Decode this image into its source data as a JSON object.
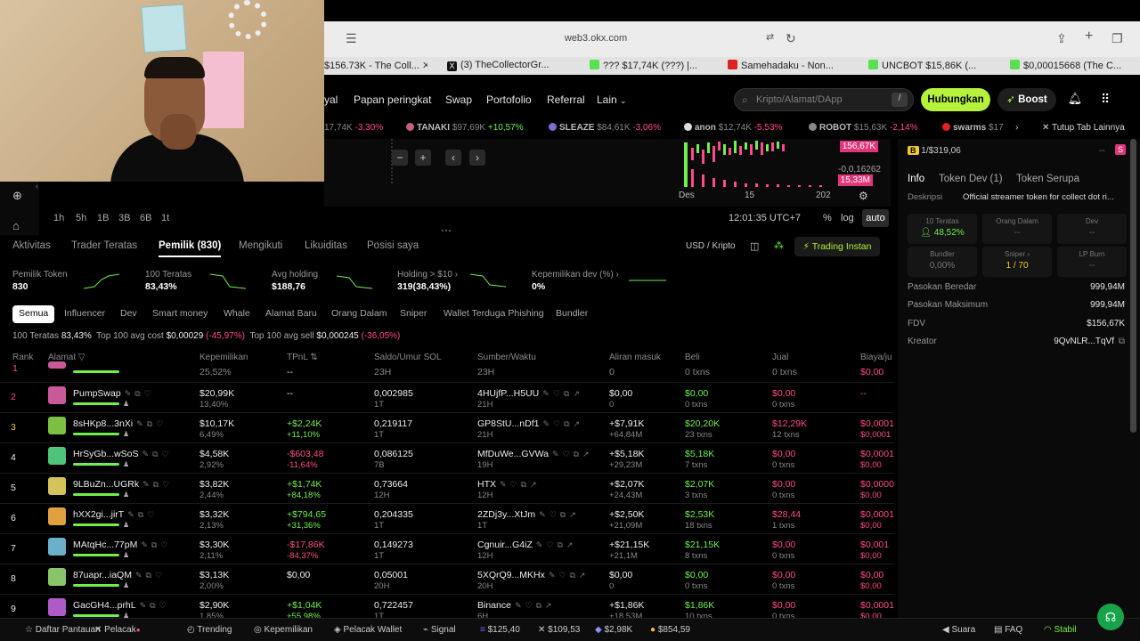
{
  "browser": {
    "url": "web3.okx.com",
    "tabs": [
      {
        "label": "$156.73K - The Coll...",
        "color": "#e2e2e2"
      },
      {
        "label": "(3) TheCollectorGr...",
        "color": "#111111"
      },
      {
        "label": "??? $17,74K (???) |...",
        "color": "#58e04f"
      },
      {
        "label": "Samehadaku - Non...",
        "color": "#d22"
      },
      {
        "label": "UNCBOT $15,86K (...",
        "color": "#58e04f"
      },
      {
        "label": "$0,00015668 (The C...",
        "color": "#58e04f"
      }
    ]
  },
  "nav": {
    "items": [
      "yal",
      "Papan peringkat",
      "Swap",
      "Portofolio",
      "Referral",
      "Lain"
    ],
    "search_placeholder": "Kripto/Alamat/DApp",
    "search_kbd": "/",
    "connect_label": "Hubungkan",
    "boost_label": "Boost"
  },
  "ticker": [
    {
      "name": "",
      "mc": "17,74K",
      "chg": "-3,30%",
      "dir": "neg",
      "color": ""
    },
    {
      "name": "TANAKI",
      "mc": "$97,69K",
      "chg": "+10,57%",
      "dir": "pos",
      "color": "#c4607a"
    },
    {
      "name": "SLEAZE",
      "mc": "$84,61K",
      "chg": "-3,06%",
      "dir": "neg",
      "color": "#7a6fd0"
    },
    {
      "name": "anon",
      "mc": "$12,74K",
      "chg": "-5,53%",
      "dir": "neg",
      "color": "#ddd"
    },
    {
      "name": "ROBOT",
      "mc": "$15,63K",
      "chg": "-2,14%",
      "dir": "neg",
      "color": "#888"
    },
    {
      "name": "swarms",
      "mc": "$17",
      "chg": "",
      "dir": "neg",
      "color": "#d22"
    }
  ],
  "ticker_close": "Tutup Tab Lainnya",
  "chart": {
    "price_badge_1": "156,67K",
    "price_badge_2": "15,33M",
    "axis_val": "-0,0,16262",
    "x_labels": [
      "Des",
      "15",
      "202"
    ],
    "timeframes": [
      "1h",
      "5h",
      "1B",
      "3B",
      "6B",
      "1t"
    ],
    "clock": "12:01:35 UTC+7",
    "pct": "%",
    "log": "log",
    "auto": "auto"
  },
  "right_panel": {
    "bundle_row": "1/$319,06",
    "tabs": [
      "Info",
      "Token Dev (1)",
      "Token Serupa"
    ],
    "desc_label": "Deskripsi",
    "desc_value": "Official streamer token for collect dot ri...",
    "stats": [
      {
        "label": "10 Teratas",
        "value": "48,52%",
        "tone": "pos"
      },
      {
        "label": "Orang Dalam",
        "value": "--",
        "tone": "dim"
      },
      {
        "label": "Dev",
        "value": "--",
        "tone": "dim"
      },
      {
        "label": "Bundler",
        "value": "0,00%",
        "tone": "dim"
      },
      {
        "label": "Sniper",
        "value": "1 / 70",
        "tone": "warn"
      },
      {
        "label": "LP Burn",
        "value": "--",
        "tone": "dim"
      }
    ],
    "rows": [
      {
        "label": "Pasokan Beredar",
        "value": "999,94M"
      },
      {
        "label": "Pasokan Maksimum",
        "value": "999,94M"
      },
      {
        "label": "FDV",
        "value": "$156,67K"
      },
      {
        "label": "Kreator",
        "value": "9QvNLR...TqVf"
      }
    ]
  },
  "main_tabs": [
    "Aktivitas",
    "Trader Teratas",
    "Pemilik (830)",
    "Mengikuti",
    "Likuiditas",
    "Posisi saya"
  ],
  "currency_toggle": "USD / Kripto",
  "trade_btn": "Trading Instan",
  "summary": [
    {
      "label": "Pemilik Token",
      "value": "830"
    },
    {
      "label": "100 Teratas",
      "value": "83,43%"
    },
    {
      "label": "Avg holding",
      "value": "$188,76"
    },
    {
      "label": "Holding > $10",
      "value": "319(38,43%)"
    },
    {
      "label": "Kepemilikan dev (%)",
      "value": "0%"
    }
  ],
  "chips": [
    "Semua",
    "Influencer",
    "Dev",
    "Smart money",
    "Whale",
    "Alamat Baru",
    "Orang Dalam",
    "Sniper",
    "Wallet Terduga Phishing",
    "Bundler"
  ],
  "aggregate": {
    "top100_label": "100 Teratas",
    "top100_value": "83,43%",
    "avg_cost_label": "Top 100 avg cost",
    "avg_cost_value": "$0,00029",
    "avg_cost_chg": "(-45,97%)",
    "avg_sell_label": "Top 100 avg sell",
    "avg_sell_value": "$0,000245",
    "avg_sell_chg": "(-36,05%)"
  },
  "table": {
    "headers": [
      "Rank",
      "Alamat",
      "Kepemilikan",
      "TPnL",
      "Saldo/Umur SOL",
      "Sumber/Waktu",
      "Aliran masuk",
      "Beli",
      "Jual",
      "Biaya/ju"
    ],
    "partial_row": {
      "rank": "1",
      "hold_pct": "25,52%",
      "pnl": "--",
      "age": "23H",
      "src_age": "23H",
      "flow": "0",
      "buy": "0 txns",
      "sell": "0 txns",
      "fee": "$0,00"
    },
    "rows": [
      {
        "rank": "2",
        "addr": "PumpSwap",
        "hold": "$20,99K",
        "hold_pct": "13,40%",
        "pnl": "--",
        "pnl_pct": "",
        "pnl_dir": "w",
        "sol": "0,002985",
        "age": "1T",
        "src": "4HUjfP...H5UU",
        "src_age": "21H",
        "flow": "$0,00",
        "flow_sub": "0",
        "buy": "$0,00",
        "buy_tx": "0 txns",
        "sell": "$0,00",
        "sell_tx": "0 txns",
        "fee": "--",
        "fee2": "",
        "avatar": "#c85a9a",
        "rank_col": "#ff4a8a"
      },
      {
        "rank": "3",
        "addr": "8sHKp8...3nXi",
        "hold": "$10,17K",
        "hold_pct": "6,49%",
        "pnl": "+$2,24K",
        "pnl_pct": "+11,10%",
        "pnl_dir": "g",
        "sol": "0,219117",
        "age": "1T",
        "src": "GP8StU...nDf1",
        "src_age": "21H",
        "flow": "+$7,91K",
        "flow_sub": "+64,84M",
        "buy": "$20,20K",
        "buy_tx": "23 txns",
        "sell": "$12,29K",
        "sell_tx": "12 txns",
        "fee": "$0,0001",
        "fee2": "$0,0001",
        "avatar": "#7bc043",
        "rank_col": "#f5c542"
      },
      {
        "rank": "4",
        "addr": "HrSyGb...wSoS",
        "hold": "$4,58K",
        "hold_pct": "2,92%",
        "pnl": "-$603,48",
        "pnl_pct": "-11,64%",
        "pnl_dir": "r",
        "sol": "0,086125",
        "age": "7B",
        "src": "MfDuWe...GVWa",
        "src_age": "19H",
        "flow": "+$5,18K",
        "flow_sub": "+29,23M",
        "buy": "$5,18K",
        "buy_tx": "7 txns",
        "sell": "$0,00",
        "sell_tx": "0 txns",
        "fee": "$0,0001",
        "fee2": "$0,00",
        "avatar": "#4fc37a",
        "rank_col": "#eee"
      },
      {
        "rank": "5",
        "addr": "9LBuZn...UGRk",
        "hold": "$3,82K",
        "hold_pct": "2,44%",
        "pnl": "+$1,74K",
        "pnl_pct": "+84,18%",
        "pnl_dir": "g",
        "sol": "0,73664",
        "age": "12H",
        "src": "HTX",
        "src_age": "12H",
        "flow": "+$2,07K",
        "flow_sub": "+24,43M",
        "buy": "$2,07K",
        "buy_tx": "3 txns",
        "sell": "$0,00",
        "sell_tx": "0 txns",
        "fee": "$0,0000",
        "fee2": "$0,00",
        "avatar": "#d4c35a",
        "rank_col": "#eee"
      },
      {
        "rank": "6",
        "addr": "hXX2gi...jirT",
        "hold": "$3,32K",
        "hold_pct": "2,13%",
        "pnl": "+$794,65",
        "pnl_pct": "+31,36%",
        "pnl_dir": "g",
        "sol": "0,204335",
        "age": "1T",
        "src": "2ZDj3y...XtJm",
        "src_age": "1T",
        "flow": "+$2,50K",
        "flow_sub": "+21,09M",
        "buy": "$2,53K",
        "buy_tx": "18 txns",
        "sell": "$28,44",
        "sell_tx": "1 txns",
        "fee": "$0,0001",
        "fee2": "$0,00",
        "avatar": "#e0a040",
        "rank_col": "#eee"
      },
      {
        "rank": "7",
        "addr": "MAtqHc...77pM",
        "hold": "$3,30K",
        "hold_pct": "2,11%",
        "pnl": "-$17,86K",
        "pnl_pct": "-84,37%",
        "pnl_dir": "r",
        "sol": "0,149273",
        "age": "1T",
        "src": "Cgnuir...G4iZ",
        "src_age": "12H",
        "flow": "+$21,15K",
        "flow_sub": "+21,1M",
        "buy": "$21,15K",
        "buy_tx": "8 txns",
        "sell": "$0,00",
        "sell_tx": "0 txns",
        "fee": "$0,001",
        "fee2": "$0,00",
        "avatar": "#6ab0c8",
        "rank_col": "#eee"
      },
      {
        "rank": "8",
        "addr": "87uapr...iaQM",
        "hold": "$3,13K",
        "hold_pct": "2,00%",
        "pnl": "$0,00",
        "pnl_pct": "",
        "pnl_dir": "w",
        "sol": "0,05001",
        "age": "20H",
        "src": "5XQrQ9...MKHx",
        "src_age": "20H",
        "flow": "$0,00",
        "flow_sub": "0",
        "buy": "$0,00",
        "buy_tx": "0 txns",
        "sell": "$0,00",
        "sell_tx": "0 txns",
        "fee": "$0,00",
        "fee2": "$0,00",
        "avatar": "#8ac46a",
        "rank_col": "#eee"
      },
      {
        "rank": "9",
        "addr": "GacGH4...prhL",
        "hold": "$2,90K",
        "hold_pct": "1,85%",
        "pnl": "+$1,04K",
        "pnl_pct": "+55,98%",
        "pnl_dir": "g",
        "sol": "0,722457",
        "age": "1T",
        "src": "Binance",
        "src_age": "6H",
        "flow": "+$1,86K",
        "flow_sub": "+18,53M",
        "buy": "$1,86K",
        "buy_tx": "10 txns",
        "sell": "$0,00",
        "sell_tx": "0 txns",
        "fee": "$0,0001",
        "fee2": "$0,00",
        "avatar": "#b05ac8",
        "rank_col": "#eee"
      }
    ]
  },
  "footer": {
    "items": [
      "Daftar Pantauan",
      "Pelacak",
      "Trending",
      "Kepemilikan",
      "Pelacak Wallet",
      "Signal"
    ],
    "prices": [
      {
        "value": "$125,40",
        "color": "#7b5cff"
      },
      {
        "value": "$109,53",
        "color": "#fff"
      },
      {
        "value": "$2,98K",
        "color": "#8a92f0"
      },
      {
        "value": "$854,59",
        "color": "#f3ba2f"
      }
    ],
    "right": [
      "Suara",
      "FAQ",
      "Stabil"
    ]
  },
  "colors": {
    "accent": "#b6f23c",
    "positive": "#6ff04b",
    "negative": "#ff4a8a"
  }
}
